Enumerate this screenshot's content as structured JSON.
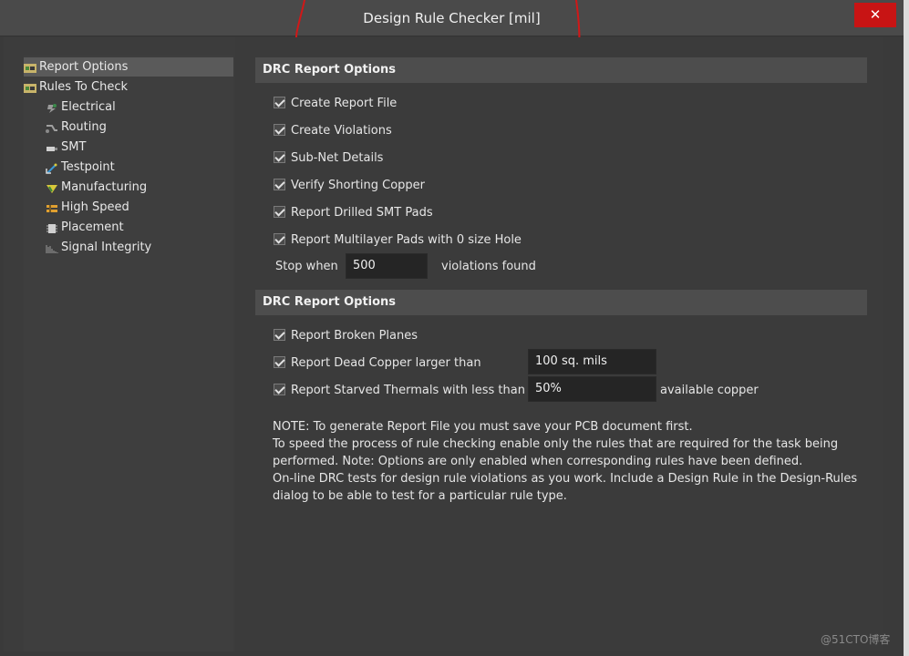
{
  "window": {
    "title": "Design Rule Checker [mil]",
    "close_label": "✕"
  },
  "tree": {
    "items": [
      {
        "label": "Report Options",
        "icon": "report-options-icon"
      },
      {
        "label": "Rules To Check",
        "icon": "rules-to-check-icon"
      },
      {
        "label": "Electrical",
        "icon": "electrical-icon"
      },
      {
        "label": "Routing",
        "icon": "routing-icon"
      },
      {
        "label": "SMT",
        "icon": "smt-icon"
      },
      {
        "label": "Testpoint",
        "icon": "testpoint-icon"
      },
      {
        "label": "Manufacturing",
        "icon": "manufacturing-icon"
      },
      {
        "label": "High Speed",
        "icon": "high-speed-icon"
      },
      {
        "label": "Placement",
        "icon": "placement-icon"
      },
      {
        "label": "Signal Integrity",
        "icon": "signal-integrity-icon"
      }
    ]
  },
  "section1": {
    "header": "DRC Report Options",
    "options": [
      {
        "label": "Create Report File",
        "checked": true
      },
      {
        "label": "Create Violations",
        "checked": true
      },
      {
        "label": "Sub-Net Details",
        "checked": true
      },
      {
        "label": "Verify Shorting Copper",
        "checked": true
      },
      {
        "label": "Report Drilled SMT Pads",
        "checked": true
      },
      {
        "label": "Report Multilayer Pads with 0 size Hole",
        "checked": true
      }
    ],
    "stop_when_label": "Stop when",
    "stop_when_value": "500",
    "violations_found_label": "violations found"
  },
  "section2": {
    "header": "DRC Report Options",
    "broken_planes_label": "Report Broken Planes",
    "dead_copper_label": "Report Dead Copper larger than",
    "dead_copper_value": "100 sq. mils",
    "starved_thermals_label": "Report Starved Thermals with less than",
    "starved_thermals_value": "50%",
    "available_copper_label": "available copper"
  },
  "note": {
    "lines": [
      "NOTE: To generate Report File you must save your PCB document first.",
      "To speed the process of rule checking enable only the rules that are required for the task being",
      "performed.  Note: Options are only enabled when corresponding rules have been defined.",
      "On-line DRC tests for design rule violations as you work. Include a Design Rule in the Design-Rules",
      "dialog to be able to test for a particular rule  type."
    ]
  },
  "watermark": "@51CTO博客",
  "colors": {
    "background": "#3b3b3b",
    "header": "#4d4d4d",
    "close": "#c81414",
    "annotation": "#d01818"
  }
}
